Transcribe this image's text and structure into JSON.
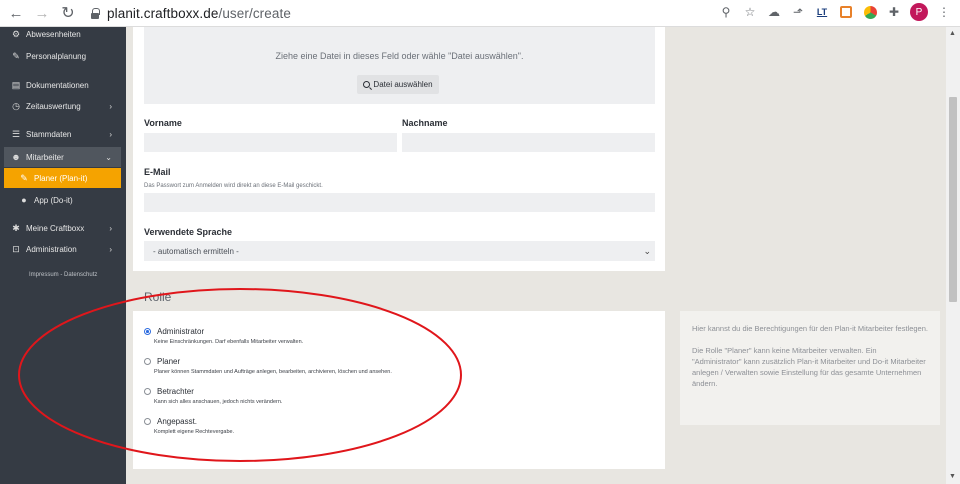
{
  "browser": {
    "url_host": "planit.craftboxx.de",
    "url_path": "/user/create",
    "avatar_letter": "P",
    "ext_lt": "LT"
  },
  "sidebar": {
    "items": [
      {
        "label": "Abwesenheiten",
        "icon": "users-cog-icon"
      },
      {
        "label": "Personalplanung",
        "icon": "user-edit-icon"
      },
      {
        "label": "Dokumentationen",
        "icon": "document-icon"
      },
      {
        "label": "Zeitauswertung",
        "icon": "clock-icon"
      },
      {
        "label": "Stammdaten",
        "icon": "database-icon"
      },
      {
        "label": "Mitarbeiter",
        "icon": "users-icon"
      },
      {
        "label": "Planer (Plan-it)",
        "icon": "user-edit-icon"
      },
      {
        "label": "App (Do-it)",
        "icon": "user-icon"
      },
      {
        "label": "Meine Craftboxx",
        "icon": "gear-icon"
      },
      {
        "label": "Administration",
        "icon": "unlock-icon"
      }
    ],
    "footer": "Impressum - Datenschutz"
  },
  "form": {
    "dropzone_text": "Ziehe eine Datei in dieses Feld oder wähle \"Datei auswählen\".",
    "dropzone_button": "Datei auswählen",
    "firstname_label": "Vorname",
    "lastname_label": "Nachname",
    "email_label": "E-Mail",
    "email_hint": "Das Passwort zum Anmelden wird direkt an diese E-Mail geschickt.",
    "language_label": "Verwendete Sprache",
    "language_value": "- automatisch ermitteln -"
  },
  "role": {
    "title": "Rolle",
    "options": [
      {
        "label": "Administrator",
        "desc": "Keine Einschränkungen. Darf ebenfalls Mitarbeiter verwalten.",
        "selected": true
      },
      {
        "label": "Planer",
        "desc": "Planer können Stammdaten und Aufträge anlegen, bearbeiten, archivieren, löschen und ansehen.",
        "selected": false
      },
      {
        "label": "Betrachter",
        "desc": "Kann sich alles anschauen, jedoch nichts verändern.",
        "selected": false
      },
      {
        "label": "Angepasst.",
        "desc": "Komplett eigene Rechtevergabe.",
        "selected": false
      }
    ],
    "info_p1": "Hier kannst du die Berechtigungen für den Plan-it Mitarbeiter festlegen.",
    "info_p2": "Die Rolle \"Planer\" kann keine Mitarbeiter verwalten. Ein \"Administrator\" kann zusätzlich Plan-it Mitarbeiter und Do-it Mitarbeiter anlegen / Verwalten sowie Einstellung für das gesamte Unternehmen ändern."
  },
  "colors": {
    "sidebar_bg": "#353b44",
    "accent": "#f5a300",
    "annotation": "#e0161b"
  }
}
